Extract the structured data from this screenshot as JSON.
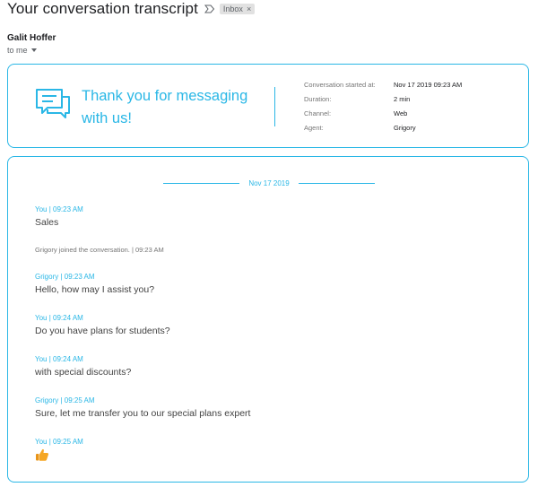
{
  "email": {
    "subject": "Your conversation transcript",
    "label": "Inbox",
    "label_close": "×",
    "sender": "Galit Hoffer",
    "recipient": "to me"
  },
  "summary": {
    "thanks": "Thank you for messaging with us!",
    "meta": [
      {
        "label": "Conversation started at:",
        "value": "Nov 17 2019 09:23 AM"
      },
      {
        "label": "Duration:",
        "value": "2 min"
      },
      {
        "label": "Channel:",
        "value": "Web"
      },
      {
        "label": "Agent:",
        "value": "Grigory"
      }
    ]
  },
  "transcript": {
    "date": "Nov 17 2019",
    "messages": [
      {
        "meta": "You | 09:23 AM",
        "text": "Sales"
      },
      {
        "system": "Grigory joined the conversation. | 09:23 AM"
      },
      {
        "meta": "Grigory | 09:23 AM",
        "text": "Hello, how may I assist you?"
      },
      {
        "meta": "You | 09:24 AM",
        "text": "Do you have plans for students?"
      },
      {
        "meta": "You | 09:24 AM",
        "text": "with special discounts?"
      },
      {
        "meta": "Grigory | 09:25 AM",
        "text": "Sure, let me transfer you to our special plans expert"
      },
      {
        "meta": "You | 09:25 AM",
        "emoji": "thumbs-up"
      }
    ]
  },
  "colors": {
    "accent": "#2ab7e6",
    "emoji": "#f5a623"
  }
}
